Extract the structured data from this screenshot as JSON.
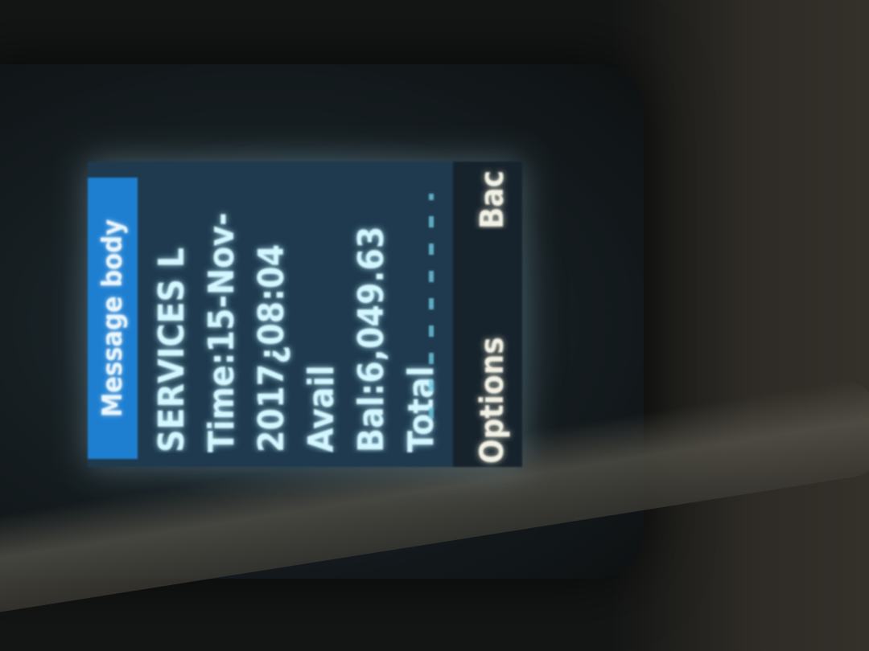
{
  "screen": {
    "title": "Message body",
    "lines": [
      "SERVICES L",
      "Time:15-Nov-",
      "2017¿08:04",
      "Avail",
      "Bal:6,049.63",
      "Total"
    ],
    "softkeys": {
      "left": "Options",
      "right": "Bac"
    }
  },
  "colors": {
    "title_bar": "#1e7fd1",
    "screen_bg": "#1f3a4e",
    "text": "#d4f6ff"
  }
}
